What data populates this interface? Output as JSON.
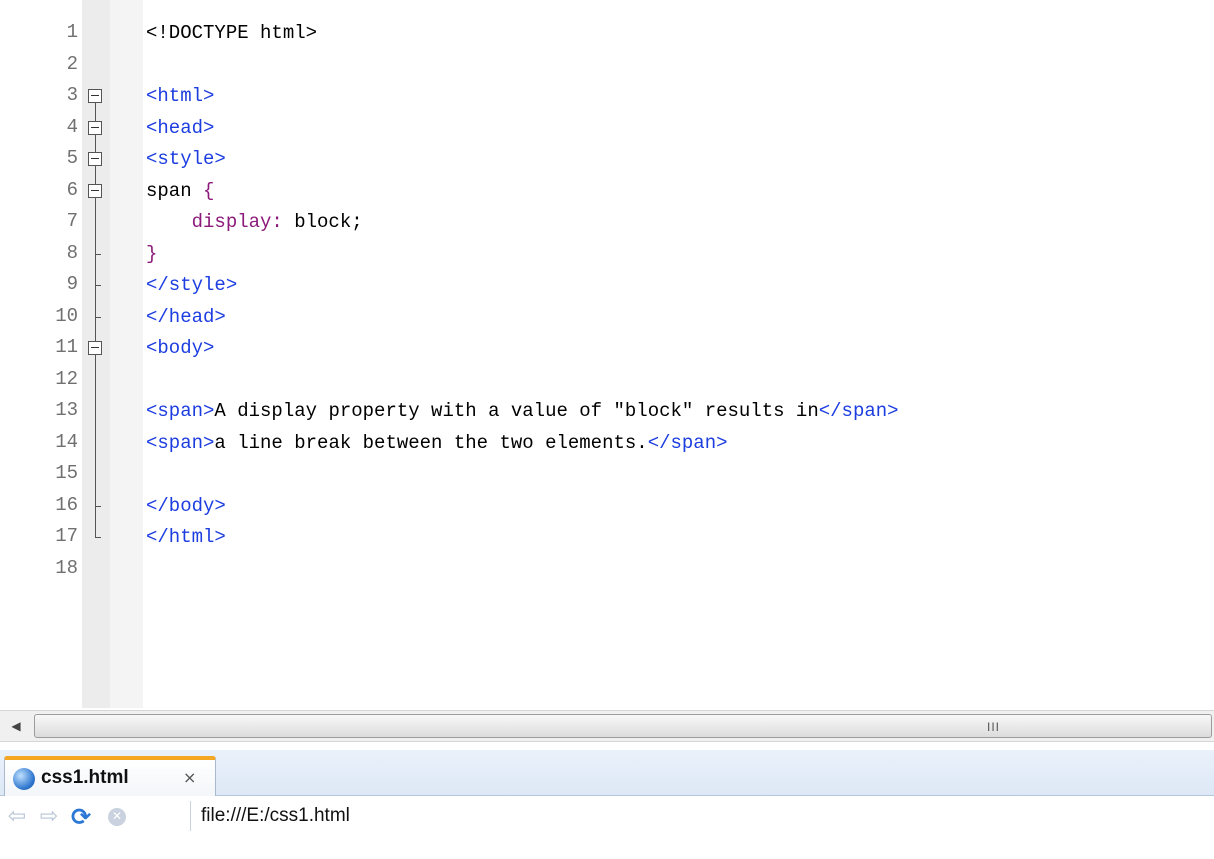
{
  "editor": {
    "lines": [
      {
        "num": "1",
        "segments": [
          {
            "cls": "txt",
            "text": "<!DOCTYPE html>"
          }
        ]
      },
      {
        "num": "2",
        "segments": []
      },
      {
        "num": "3",
        "segments": [
          {
            "cls": "tag",
            "text": "<html>"
          }
        ]
      },
      {
        "num": "4",
        "segments": [
          {
            "cls": "tag",
            "text": "<head>"
          }
        ]
      },
      {
        "num": "5",
        "segments": [
          {
            "cls": "tag",
            "text": "<style>"
          }
        ]
      },
      {
        "num": "6",
        "segments": [
          {
            "cls": "txt",
            "text": "span "
          },
          {
            "cls": "brace",
            "text": "{"
          }
        ]
      },
      {
        "num": "7",
        "segments": [
          {
            "cls": "prop",
            "text": "    display:"
          },
          {
            "cls": "txt",
            "text": " block;"
          }
        ]
      },
      {
        "num": "8",
        "segments": [
          {
            "cls": "brace",
            "text": "}"
          }
        ]
      },
      {
        "num": "9",
        "segments": [
          {
            "cls": "tag",
            "text": "</style>"
          }
        ]
      },
      {
        "num": "10",
        "segments": [
          {
            "cls": "tag",
            "text": "</head>"
          }
        ]
      },
      {
        "num": "11",
        "segments": [
          {
            "cls": "tag",
            "text": "<body>"
          }
        ]
      },
      {
        "num": "12",
        "segments": []
      },
      {
        "num": "13",
        "segments": [
          {
            "cls": "tag",
            "text": "<span>"
          },
          {
            "cls": "txt",
            "text": "A display property with a value of \"block\" results in"
          },
          {
            "cls": "tag",
            "text": "</span>"
          }
        ]
      },
      {
        "num": "14",
        "segments": [
          {
            "cls": "tag",
            "text": "<span>"
          },
          {
            "cls": "txt",
            "text": "a line break between the two elements."
          },
          {
            "cls": "tag",
            "text": "</span>"
          }
        ]
      },
      {
        "num": "15",
        "segments": []
      },
      {
        "num": "16",
        "segments": [
          {
            "cls": "tag",
            "text": "</body>"
          }
        ]
      },
      {
        "num": "17",
        "segments": [
          {
            "cls": "tag",
            "text": "</html>"
          }
        ]
      },
      {
        "num": "18",
        "segments": []
      }
    ],
    "fold_markers": {
      "3": "box",
      "4": "box",
      "5": "box",
      "6": "box",
      "7": "line",
      "8": "tick",
      "9": "tick",
      "10": "tick",
      "11": "box",
      "12": "line",
      "13": "line",
      "14": "line",
      "15": "line",
      "16": "tick",
      "17": "end",
      "18": "none",
      "1": "none",
      "2": "none"
    },
    "colors": {
      "tag": "#1c3de0",
      "text": "#000000",
      "property": "#8c1a7a"
    }
  },
  "scrollbar": {
    "left_arrow_icon": "arrow-left-icon",
    "grip_label": "III"
  },
  "browser": {
    "tab": {
      "title": "css1.html",
      "close_label": "×",
      "icon": "globe-icon"
    },
    "nav": {
      "back_icon": "back-arrow-icon",
      "forward_icon": "forward-arrow-icon",
      "refresh_icon": "refresh-icon",
      "stop_icon": "stop-icon"
    },
    "address": "file:///E:/css1.html"
  }
}
